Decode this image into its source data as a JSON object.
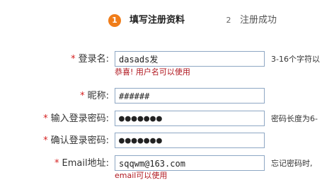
{
  "steps": [
    {
      "number": "1",
      "label": "填写注册资料"
    },
    {
      "number": "2",
      "label": "注册成功"
    }
  ],
  "required_mark": "*",
  "form": {
    "username": {
      "label": "登录名:",
      "value": "dasads发",
      "hint": "3-16个字符以",
      "message": "恭喜! 用户名可以使用"
    },
    "nickname": {
      "label": "昵称:",
      "value": "######"
    },
    "password": {
      "label": "输入登录密码:",
      "value": "●●●●●●●",
      "hint": "密码长度为6-"
    },
    "confirm_password": {
      "label": "确认登录密码:",
      "value": "●●●●●●●"
    },
    "email": {
      "label": "Email地址:",
      "value": "sqqwm@163.com",
      "hint": "忘记密码时,",
      "message": "email可以使用"
    }
  },
  "colors": {
    "accent": "#f07d1a",
    "required": "#d52020",
    "message": "#b0171f",
    "input_border": "#8ea7c4"
  }
}
